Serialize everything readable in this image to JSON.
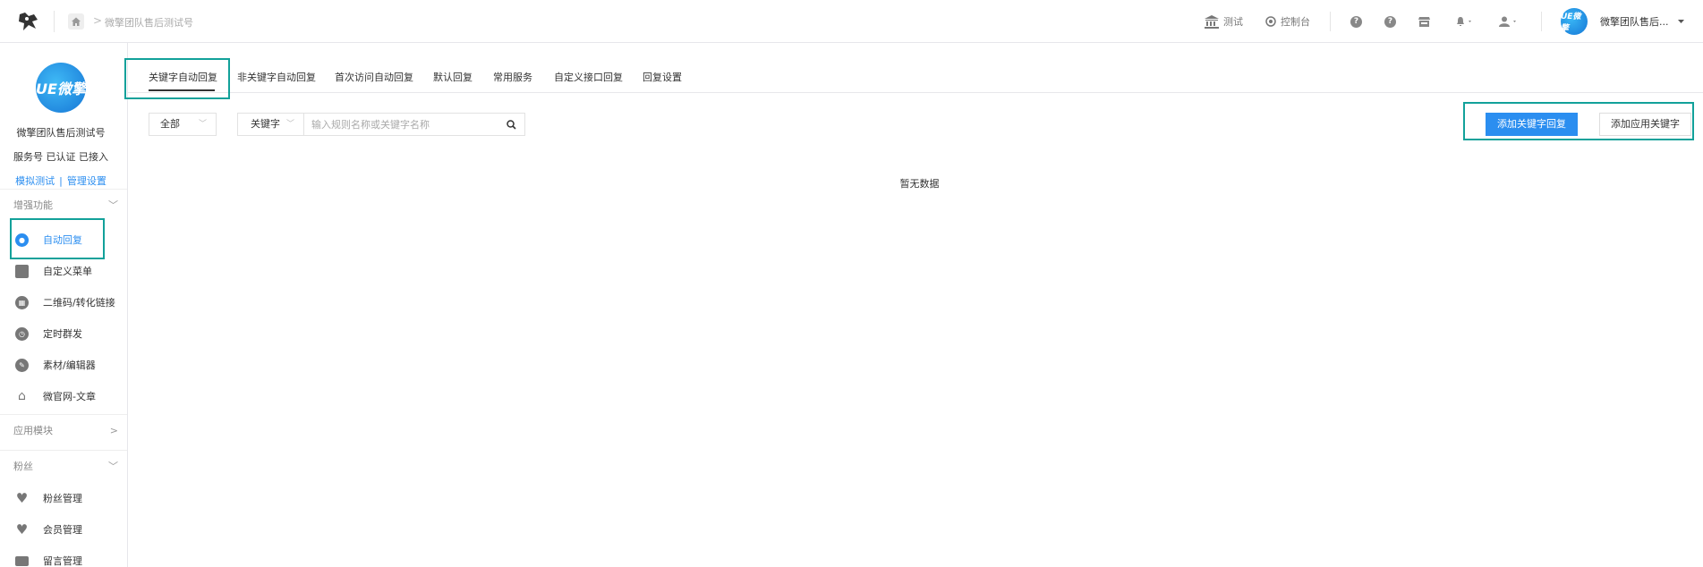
{
  "breadcrumb": {
    "account": "微擎团队售后测试号"
  },
  "header": {
    "test_label": "测试",
    "console_label": "控制台",
    "user_name": "微擎团队售后...",
    "avatar_text": "UE微擎"
  },
  "sidebar": {
    "avatar_text": "UE微擎",
    "account_name": "微擎团队售后测试号",
    "account_status": "服务号 已认证 已接入",
    "link_simulate": "模拟测试",
    "link_separator": "|",
    "link_manage": "管理设置",
    "sections": [
      {
        "title": "增强功能",
        "chevron": "﹀"
      },
      {
        "title": "应用模块",
        "chevron": ">"
      },
      {
        "title": "粉丝",
        "chevron": "﹀"
      }
    ],
    "items": [
      {
        "label": "自动回复"
      },
      {
        "label": "自定义菜单"
      },
      {
        "label": "二维码/转化链接"
      },
      {
        "label": "定时群发"
      },
      {
        "label": "素材/编辑器"
      },
      {
        "label": "微官网-文章"
      },
      {
        "label": "粉丝管理"
      },
      {
        "label": "会员管理"
      },
      {
        "label": "留言管理"
      }
    ]
  },
  "tabs": [
    {
      "label": "关键字自动回复"
    },
    {
      "label": "非关键字自动回复"
    },
    {
      "label": "首次访问自动回复"
    },
    {
      "label": "默认回复"
    },
    {
      "label": "常用服务"
    },
    {
      "label": "自定义接口回复"
    },
    {
      "label": "回复设置"
    }
  ],
  "filters": {
    "scope_value": "全部",
    "search_type_value": "关键字",
    "search_placeholder": "输入规则名称或关键字名称"
  },
  "actions": {
    "add_keyword_reply": "添加关键字回复",
    "add_app_keyword": "添加应用关键字"
  },
  "empty_state": "暂无数据",
  "colors": {
    "accent": "#2b8ef0",
    "highlight_box": "#12a19a"
  }
}
